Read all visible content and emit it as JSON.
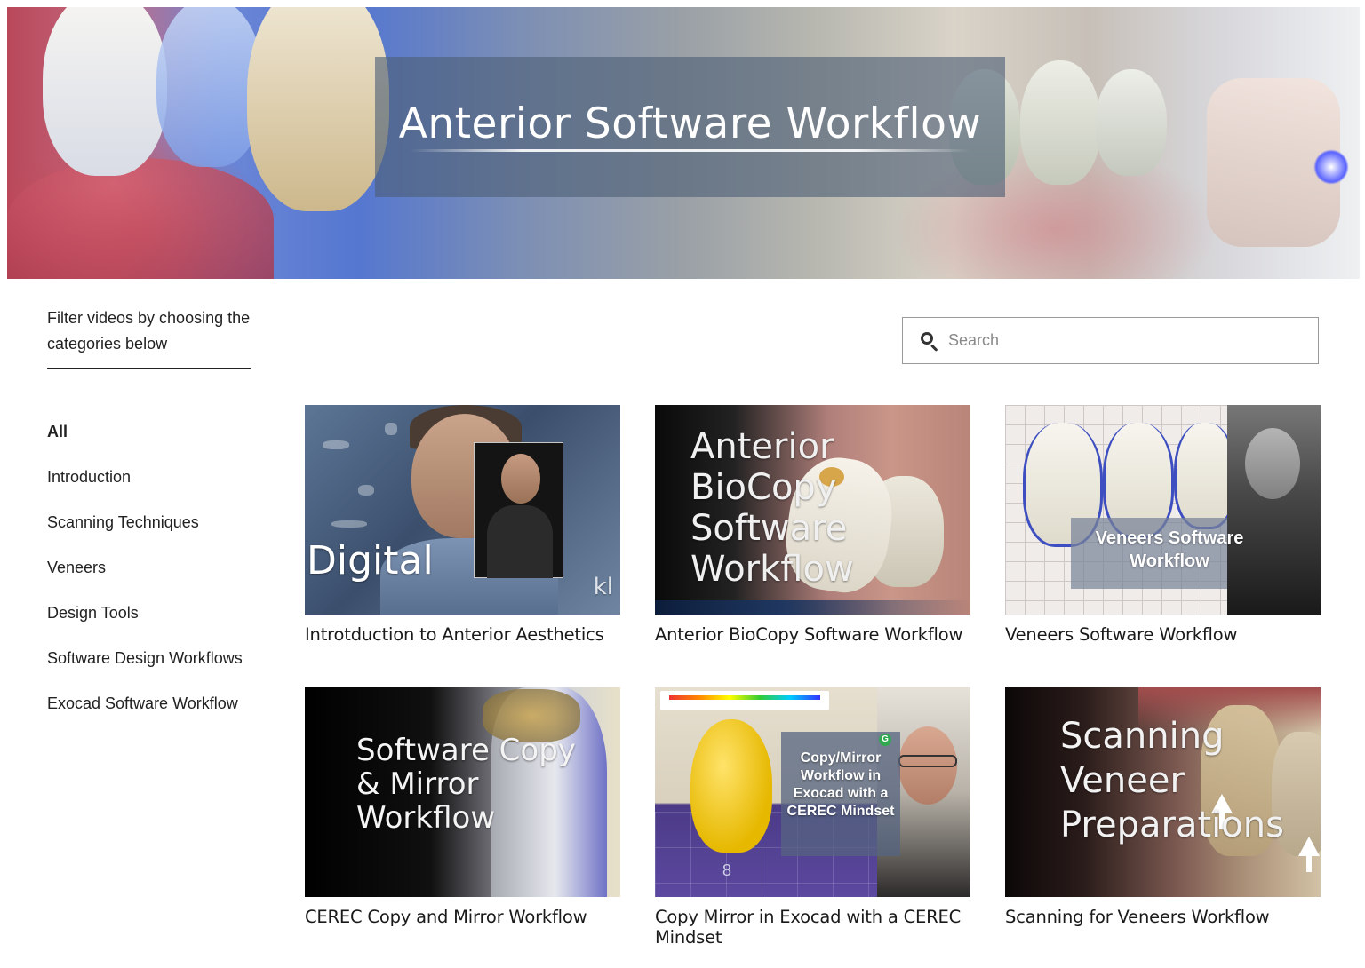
{
  "hero": {
    "title": "Anterior Software Workflow"
  },
  "sidebar": {
    "intro": "Filter videos by choosing the categories below",
    "categories": [
      {
        "label": "All",
        "active": true
      },
      {
        "label": "Introduction",
        "active": false
      },
      {
        "label": "Scanning Techniques",
        "active": false
      },
      {
        "label": "Veneers",
        "active": false
      },
      {
        "label": "Design Tools",
        "active": false
      },
      {
        "label": "Software Design Workflows",
        "active": false
      },
      {
        "label": "Exocad Software Workflow",
        "active": false
      }
    ]
  },
  "search": {
    "placeholder": "Search",
    "value": "",
    "icon": "search-icon"
  },
  "videos": [
    {
      "title": "Introtduction to Anterior Aesthetics",
      "thumb_text": "Digital",
      "thumb_logo": "kl"
    },
    {
      "title": "Anterior BioCopy Software Workflow",
      "thumb_text": "Anterior BioCopy Software Workflow"
    },
    {
      "title": "Veneers Software Workflow",
      "thumb_text": "Veneers Software Workflow"
    },
    {
      "title": "CEREC Copy and Mirror Workflow",
      "thumb_text": "Software Copy & Mirror Workflow"
    },
    {
      "title": "Copy Mirror in Exocad with a CEREC Mindset",
      "thumb_text": "Copy/Mirror Workflow in Exocad with a CEREC Mindset",
      "thumb_badge": "G",
      "thumb_number": "8"
    },
    {
      "title": "Scanning for Veneers Workflow",
      "thumb_text": "Scanning Veneer Preparations"
    }
  ]
}
